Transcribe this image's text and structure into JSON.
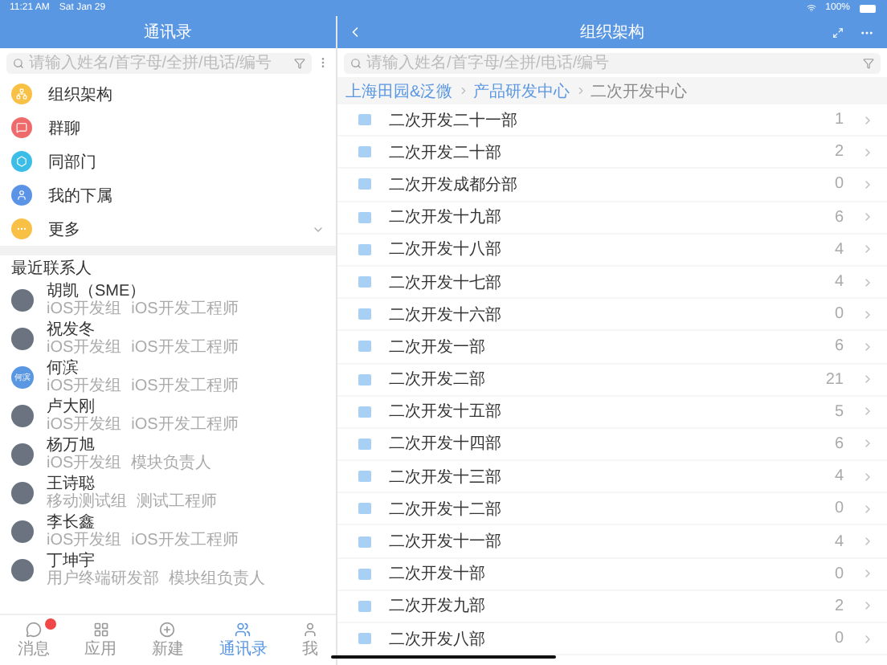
{
  "status_bar": {
    "time": "11:21 AM",
    "date": "Sat Jan 29",
    "battery": "100%"
  },
  "contacts_panel": {
    "title": "通讯录",
    "search": {
      "placeholder": "请输入姓名/首字母/全拼/电话/编号"
    },
    "menu": [
      {
        "label": "组织架构",
        "color": "#f8c146",
        "kind": "org"
      },
      {
        "label": "群聊",
        "color": "#ef6a6a",
        "kind": "chat"
      },
      {
        "label": "同部门",
        "color": "#3bbde8",
        "kind": "dept"
      },
      {
        "label": "我的下属",
        "color": "#5b93e6",
        "kind": "user"
      },
      {
        "label": "更多",
        "color": "#f8c146",
        "kind": "more",
        "expandable": true
      }
    ],
    "section_title": "最近联系人",
    "contacts": [
      {
        "name": "胡凯（SME）",
        "department": "iOS开发组",
        "title": "iOS开发工程师",
        "kind": "photo"
      },
      {
        "name": "祝发冬",
        "department": "iOS开发组",
        "title": "iOS开发工程师",
        "kind": "photo"
      },
      {
        "name": "何滨",
        "department": "iOS开发组",
        "title": "iOS开发工程师",
        "kind": "initials",
        "avatar_text": "何滨"
      },
      {
        "name": "卢大刚",
        "department": "iOS开发组",
        "title": "iOS开发工程师",
        "kind": "photo"
      },
      {
        "name": "杨万旭",
        "department": "iOS开发组",
        "title": "模块负责人",
        "kind": "photo"
      },
      {
        "name": "王诗聪",
        "department": "移动测试组",
        "title": "测试工程师",
        "kind": "photo"
      },
      {
        "name": "李长鑫",
        "department": "iOS开发组",
        "title": "iOS开发工程师",
        "kind": "photo"
      },
      {
        "name": "丁坤宇",
        "department": "用户终端研发部",
        "title": "模块组负责人",
        "kind": "photo"
      }
    ]
  },
  "tab_bar": [
    {
      "label": "消息",
      "kind": "message",
      "selected": false,
      "badge": true
    },
    {
      "label": "应用",
      "kind": "apps",
      "selected": false,
      "badge": false
    },
    {
      "label": "新建",
      "kind": "new",
      "selected": false,
      "badge": false
    },
    {
      "label": "通讯录",
      "kind": "contacts",
      "selected": true,
      "badge": false
    },
    {
      "label": "我",
      "kind": "me",
      "selected": false,
      "badge": false
    }
  ],
  "org_panel": {
    "title": "组织架构",
    "search": {
      "placeholder": "请输入姓名/首字母/全拼/电话/编号"
    },
    "breadcrumb": [
      {
        "label": "上海田园&泛微",
        "current": false
      },
      {
        "label": "产品研发中心",
        "current": false
      },
      {
        "label": "二次开发中心",
        "current": true
      }
    ],
    "departments": [
      {
        "name": "二次开发二十一部",
        "count": "1"
      },
      {
        "name": "二次开发二十部",
        "count": "2"
      },
      {
        "name": "二次开发成都分部",
        "count": "0"
      },
      {
        "name": "二次开发十九部",
        "count": "6"
      },
      {
        "name": "二次开发十八部",
        "count": "4"
      },
      {
        "name": "二次开发十七部",
        "count": "4"
      },
      {
        "name": "二次开发十六部",
        "count": "0"
      },
      {
        "name": "二次开发一部",
        "count": "6"
      },
      {
        "name": "二次开发二部",
        "count": "21"
      },
      {
        "name": "二次开发十五部",
        "count": "5"
      },
      {
        "name": "二次开发十四部",
        "count": "6"
      },
      {
        "name": "二次开发十三部",
        "count": "4"
      },
      {
        "name": "二次开发十二部",
        "count": "0"
      },
      {
        "name": "二次开发十一部",
        "count": "4"
      },
      {
        "name": "二次开发十部",
        "count": "0"
      },
      {
        "name": "二次开发九部",
        "count": "2"
      },
      {
        "name": "二次开发八部",
        "count": "0"
      }
    ]
  }
}
